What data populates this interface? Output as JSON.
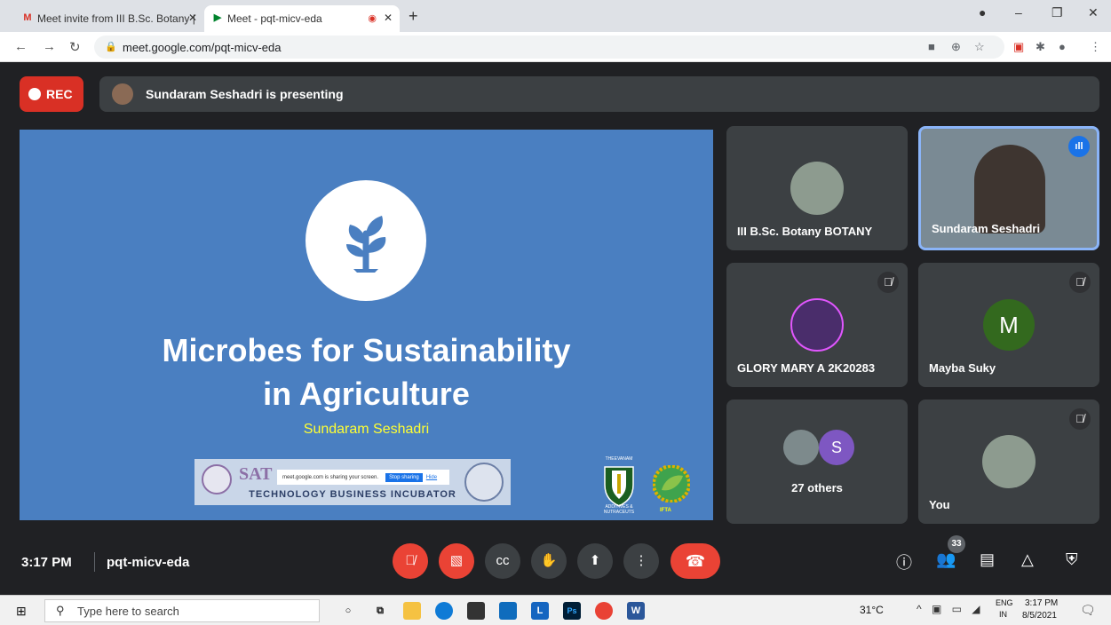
{
  "browser": {
    "tabs": [
      {
        "favicon": "M",
        "title": "Meet invite from III B.Sc. Botany |",
        "active": false
      },
      {
        "favicon": "▶",
        "title": "Meet - pqt-micv-eda",
        "active": true
      }
    ],
    "new_tab": "+",
    "url": "meet.google.com/pqt-micv-eda",
    "win_controls": {
      "minimize": "–",
      "restore": "❐",
      "close": "✕"
    }
  },
  "meet": {
    "rec_label": "REC",
    "presenting_text": "Sundaram Seshadri is presenting",
    "slide": {
      "title_line1": "Microbes for Sustainability",
      "title_line2": "in Agriculture",
      "subtitle": "Sundaram Seshadri",
      "banner_org": "SAT",
      "banner_text": "TECHNOLOGY BUSINESS INCUBATOR",
      "share_notice": "meet.google.com is sharing your screen.",
      "share_stop": "Stop sharing",
      "share_hide": "Hide",
      "logo1_top": "THEEVANAM",
      "logo1_bottom": "ADDITIVES & NUTRACEUTS",
      "logo2_label": "IFTA"
    },
    "participants": [
      {
        "name": "III B.Sc. Botany BOTANY",
        "muted": false
      },
      {
        "name": "Sundaram Seshadri",
        "muted": false,
        "speaking": true
      },
      {
        "name": "GLORY MARY A 2K20283",
        "muted": true
      },
      {
        "name": "Mayba Suky",
        "muted": true,
        "initial": "M"
      },
      {
        "name": "27 others",
        "initial": "S"
      },
      {
        "name": "You",
        "muted": true
      }
    ],
    "clock": "3:17 PM",
    "meeting_code": "pqt-micv-eda",
    "participant_count": "33"
  },
  "taskbar": {
    "search_placeholder": "Type here to search",
    "weather": "31°C",
    "lang_line1": "ENG",
    "lang_line2": "IN",
    "time": "3:17 PM",
    "date": "8/5/2021"
  },
  "colors": {
    "meet_bg": "#202124",
    "slide_bg": "#4a7fc1",
    "rec_red": "#d93025",
    "accent_blue": "#8ab4f8"
  }
}
